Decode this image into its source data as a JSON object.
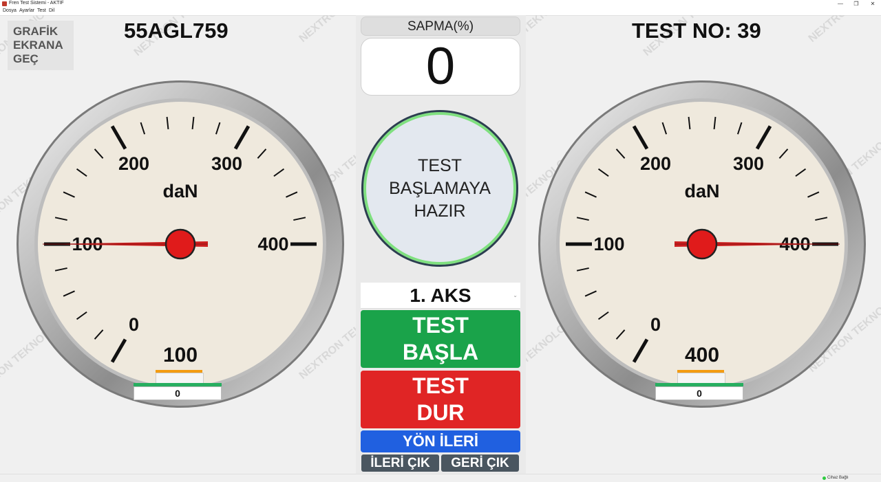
{
  "window": {
    "title": "Fren Test Sistemi - AKTİF",
    "minimize": "—",
    "restore": "❐",
    "close": "✕"
  },
  "menu": {
    "items": [
      "Dosya",
      "Ayarlar",
      "Test",
      "Dil"
    ]
  },
  "watermark_text": "NEXTRON TEKNOLOJİ",
  "toolbar": {
    "grafik_button": "GRAFİK\nEKRANA\nGEÇ"
  },
  "header": {
    "plate": "55AGL759",
    "test_no": "TEST NO: 39"
  },
  "gauge_scale": {
    "unit": "daN",
    "min": 0,
    "max": 400,
    "tick_labels": [
      "0",
      "100",
      "200",
      "300",
      "400"
    ]
  },
  "left_gauge": {
    "value": 100,
    "readout": "100",
    "indicator": "0"
  },
  "right_gauge": {
    "value": 400,
    "readout": "400",
    "indicator": "0"
  },
  "center": {
    "sapma_label": "SAPMA(%)",
    "sapma_value": "0",
    "status_text": "TEST\nBAŞLAMAYA\nHAZIR",
    "axle_select": "1. AKS",
    "start_button": "TEST\nBAŞLA",
    "stop_button": "TEST\nDUR",
    "direction_button": "YÖN İLERİ",
    "forward_exit": "İLERİ ÇIK",
    "back_exit": "GERİ ÇIK"
  },
  "status": {
    "connection": "Cihaz Bağlı"
  },
  "colors": {
    "start": "#1aa34a",
    "stop": "#e02525",
    "direction": "#2060e0",
    "needle": "#cc1f1f",
    "gauge_face": "#efe9dd"
  }
}
